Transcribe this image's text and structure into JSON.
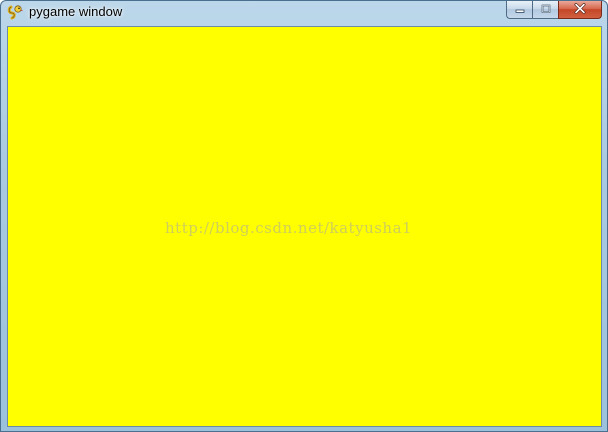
{
  "window": {
    "title": "pygame window",
    "app_icon": "pygame-snake-icon",
    "controls": {
      "minimize_icon": "minimize-icon",
      "maximize_icon": "maximize-icon",
      "close_icon": "close-icon"
    }
  },
  "canvas": {
    "fill_color": "#ffff00"
  },
  "watermark": {
    "text": "http://blog.csdn.net/katyusha1"
  }
}
